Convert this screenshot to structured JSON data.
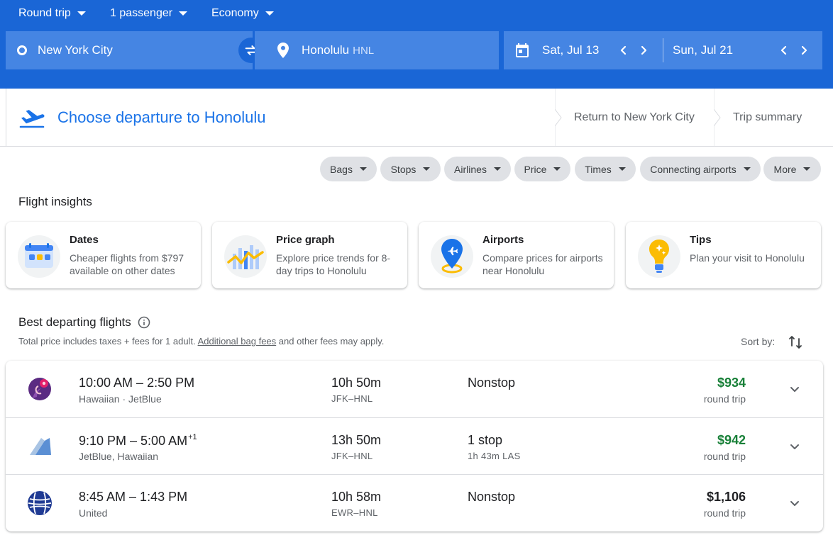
{
  "search": {
    "trip_type": "Round trip",
    "passengers": "1 passenger",
    "cabin": "Economy",
    "origin": "New York City",
    "destination": "Honolulu",
    "destination_code": "HNL",
    "depart_date": "Sat, Jul 13",
    "return_date": "Sun, Jul 21"
  },
  "steps": {
    "active": "Choose departure to Honolulu",
    "return": "Return to New York City",
    "summary": "Trip summary"
  },
  "filters": [
    "Bags",
    "Stops",
    "Airlines",
    "Price",
    "Times",
    "Connecting airports",
    "More"
  ],
  "insights": {
    "heading": "Flight insights",
    "cards": [
      {
        "title": "Dates",
        "desc": "Cheaper flights from $797 available on other dates",
        "icon": "calendar-icon"
      },
      {
        "title": "Price graph",
        "desc": "Explore price trends for 8-day trips to Honolulu",
        "icon": "price-graph-icon"
      },
      {
        "title": "Airports",
        "desc": "Compare prices for airports near Honolulu",
        "icon": "airport-pin-icon"
      },
      {
        "title": "Tips",
        "desc": "Plan your visit to Honolulu",
        "icon": "lightbulb-icon"
      }
    ]
  },
  "results": {
    "heading": "Best departing flights",
    "note_prefix": "Total price includes taxes + fees for 1 adult.",
    "note_link": "Additional bag fees",
    "note_suffix": "and other fees may apply.",
    "sort_label": "Sort by:",
    "flights": [
      {
        "times": "10:00 AM – 2:50 PM",
        "day_offset": "",
        "airline": "Hawaiian · JetBlue",
        "duration": "10h 50m",
        "route": "JFK–HNL",
        "stops": "Nonstop",
        "stop_detail": "",
        "price": "$934",
        "price_type": "round trip",
        "price_color": "#188038",
        "logo": "hawaiian-logo"
      },
      {
        "times": "9:10 PM – 5:00 AM",
        "day_offset": "+1",
        "airline": "JetBlue, Hawaiian",
        "duration": "13h 50m",
        "route": "JFK–HNL",
        "stops": "1 stop",
        "stop_detail": "1h 43m LAS",
        "price": "$942",
        "price_type": "round trip",
        "price_color": "#188038",
        "logo": "jetblue-logo"
      },
      {
        "times": "8:45 AM – 1:43 PM",
        "day_offset": "",
        "airline": "United",
        "duration": "10h 58m",
        "route": "EWR–HNL",
        "stops": "Nonstop",
        "stop_detail": "",
        "price": "$1,106",
        "price_type": "round trip",
        "price_color": "#202124",
        "logo": "united-logo"
      }
    ]
  }
}
